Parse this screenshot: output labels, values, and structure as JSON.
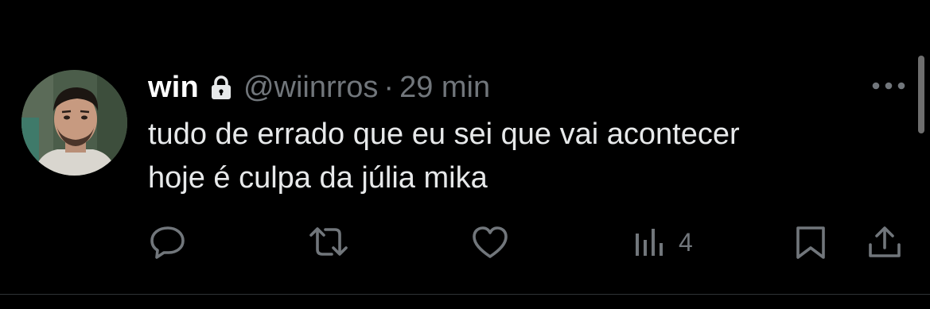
{
  "tweet": {
    "author_name": "win",
    "protected_icon": "lock-icon",
    "handle": "@wiinrros",
    "separator": "·",
    "time": "29 min",
    "text_lines": [
      "tudo de errado que eu sei que vai acontecer",
      "hoje é culpa da júlia mika"
    ],
    "views_count": "4"
  },
  "icons": {
    "more": "more-horizontal-icon",
    "reply": "reply-icon",
    "retweet": "retweet-icon",
    "like": "heart-icon",
    "views": "views-chart-icon",
    "bookmark": "bookmark-icon",
    "share": "share-icon"
  },
  "colors": {
    "background": "#000000",
    "name": "#ffffff",
    "text": "#e7e9ea",
    "muted": "#71767b",
    "divider": "#2f3336"
  }
}
